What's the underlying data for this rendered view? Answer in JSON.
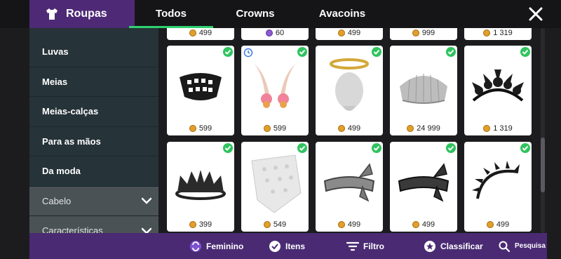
{
  "header": {
    "brand_label": "Roupas",
    "brand_icon": "shirt-icon",
    "tabs": [
      {
        "label": "Todos",
        "active": true
      },
      {
        "label": "Crowns",
        "active": false
      },
      {
        "label": "Avacoins",
        "active": false
      }
    ],
    "close_icon": "close-icon"
  },
  "sidebar": {
    "items": [
      {
        "label": "Luvas"
      },
      {
        "label": "Meias"
      },
      {
        "label": "Meias-calças"
      },
      {
        "label": "Para as mãos"
      },
      {
        "label": "Da moda"
      }
    ],
    "sections": [
      {
        "label": "Cabelo"
      },
      {
        "label": "Características"
      }
    ]
  },
  "grid": {
    "top_partial_prices": [
      "499",
      "60",
      "499",
      "999",
      "1 319"
    ],
    "items": [
      {
        "name": "mask-item",
        "price": "599",
        "owned": true,
        "timed": false
      },
      {
        "name": "bunny-ears-item",
        "price": "599",
        "owned": true,
        "timed": true
      },
      {
        "name": "halo-item",
        "price": "499",
        "owned": true,
        "timed": false
      },
      {
        "name": "chef-hat-item",
        "price": "24 999",
        "owned": true,
        "timed": false
      },
      {
        "name": "dark-flower-crown-item",
        "price": "1 319",
        "owned": true,
        "timed": false
      },
      {
        "name": "black-crown-item",
        "price": "399",
        "owned": true,
        "timed": false
      },
      {
        "name": "white-bandana-item",
        "price": "549",
        "owned": true,
        "timed": false
      },
      {
        "name": "grey-headband-item",
        "price": "499",
        "owned": true,
        "timed": false
      },
      {
        "name": "dark-headband-item",
        "price": "499",
        "owned": true,
        "timed": false
      },
      {
        "name": "spiked-headband-item",
        "price": "499",
        "owned": true,
        "timed": false
      }
    ]
  },
  "bottom_bar": {
    "gender_label": "Feminino",
    "items_label": "Itens",
    "filter_label": "Filtro",
    "sort_label": "Classificar",
    "search_label": "Pesquisa"
  },
  "colors": {
    "accent_purple": "#4e2a76",
    "active_tab_underline": "#2fd16e",
    "owned_check": "#2fc45e",
    "coin_gold": "#e0a02a",
    "sidebar_bg": "#263338"
  }
}
